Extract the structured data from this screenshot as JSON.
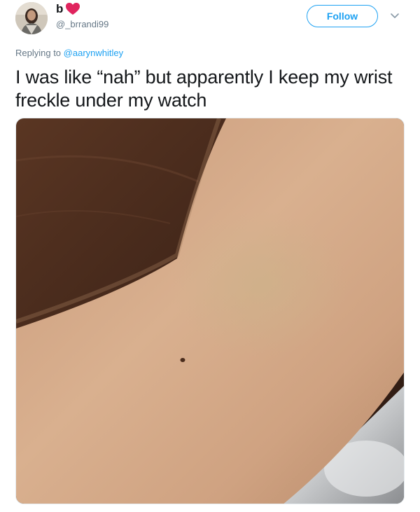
{
  "author": {
    "display_name": "b",
    "handle": "@_brrandi99",
    "avatar_icon": "avatar-photo",
    "badge_icon": "heart-icon",
    "badge_color": "#e0245e"
  },
  "actions": {
    "follow_label": "Follow",
    "more_icon": "chevron-down-icon"
  },
  "reply": {
    "prefix": "Replying to",
    "mention": "@aarynwhitley"
  },
  "tweet": {
    "text": "I was like “nah” but apparently I keep my wrist freckle under my watch"
  },
  "colors": {
    "accent": "#1da1f2",
    "secondary_text": "#657786",
    "primary_text": "#14171a"
  }
}
